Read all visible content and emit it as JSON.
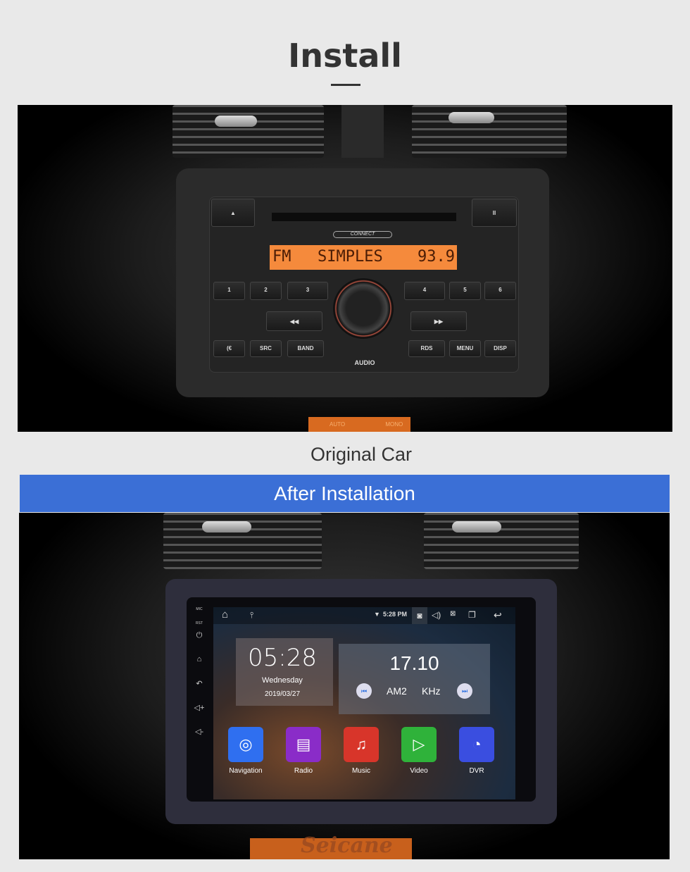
{
  "header": {
    "title": "Install"
  },
  "original": {
    "caption": "Original Car",
    "radio": {
      "brand": "CONNECT",
      "display_band": "FM",
      "display_text": "SIMPLES",
      "display_freq": "93.9",
      "buttons_top": [
        "1",
        "2",
        "3",
        "4",
        "5",
        "6"
      ],
      "buttons_bottom": [
        "SRC",
        "BAND",
        "RDS",
        "MENU",
        "DISP"
      ],
      "knob_label": "AUDIO",
      "seek": [
        "◀◀",
        "▶▶"
      ]
    },
    "lower_labels": [
      "AUTO",
      "MONO"
    ]
  },
  "after": {
    "banner": "After Installation",
    "screen": {
      "side_labels": [
        "MIC",
        "RST"
      ],
      "status_time": "5:28 PM",
      "clock": "05:28",
      "day": "Wednesday",
      "date": "2019/03/27",
      "radio_freq": "17.10",
      "radio_band": "AM2",
      "radio_unit": "KHz",
      "apps": [
        {
          "label": "Navigation",
          "color": "#2f6ff0",
          "icon": "crosshair-icon"
        },
        {
          "label": "Radio",
          "color": "#8a2cc8",
          "icon": "radio-icon"
        },
        {
          "label": "Music",
          "color": "#d8352a",
          "icon": "music-note-icon"
        },
        {
          "label": "Video",
          "color": "#2fb23a",
          "icon": "play-icon"
        },
        {
          "label": "DVR",
          "color": "#3a4ee0",
          "icon": "gauge-icon"
        }
      ]
    },
    "watermark": "Seicane"
  }
}
